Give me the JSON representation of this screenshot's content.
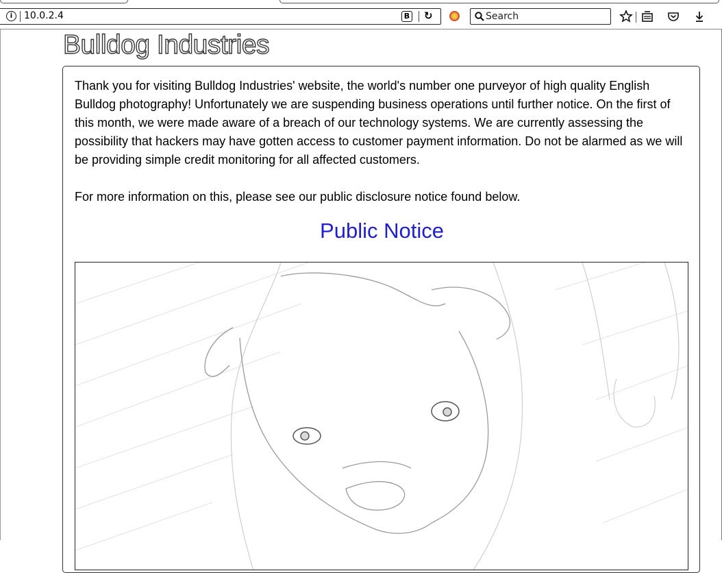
{
  "browser": {
    "url": "10.0.2.4",
    "search_placeholder": "Search",
    "icons": [
      "info-icon",
      "reader-view-icon",
      "reload-icon",
      "addon-icon",
      "search-icon",
      "bookmark-star-icon",
      "library-icon",
      "pocket-icon",
      "download-icon"
    ]
  },
  "page": {
    "title": "Bulldog Industries",
    "paragraph1": "Thank you for visiting Bulldog Industries' website, the world's number one purveyor of high quality English Bulldog photography! Unfortunately we are suspending business operations until further notice. On the first of this month, we were made aware of a breach of our technology systems. We are currently assessing the possibility that hackers may have gotten access to customer payment information. Do not be alarmed as we will be providing simple credit monitoring for all affected customers.",
    "paragraph2": "For more information on this, please see our public disclosure notice found below.",
    "notice_link": "Public Notice",
    "link_color": "#1f1fd0",
    "image_subject": "bulldog-photo"
  }
}
